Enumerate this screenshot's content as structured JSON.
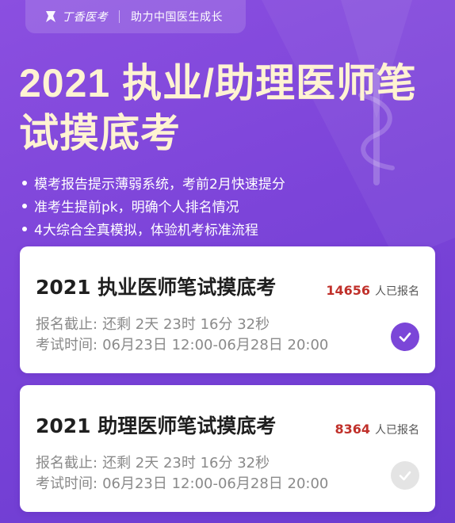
{
  "brand": {
    "name": "丁香医考",
    "slogan": "助力中国医生成长"
  },
  "headline": "2021 执业/助理医师笔试摸底考",
  "bullets": [
    "模考报告提示薄弱系统，考前2月快速提分",
    "准考生提前pk，明确个人排名情况",
    "4大综合全真模拟，体验机考标准流程"
  ],
  "exams": [
    {
      "title": "2021 执业医师笔试摸底考",
      "count": "14656",
      "count_label": "人已报名",
      "deadline_label": "报名截止:",
      "deadline_value": "还剩 2天 23时 16分 32秒",
      "time_label": "考试时间:",
      "time_value": "06月23日 12:00-06月28日 20:00",
      "selected": true
    },
    {
      "title": "2021 助理医师笔试摸底考",
      "count": "8364",
      "count_label": "人已报名",
      "deadline_label": "报名截止:",
      "deadline_value": "还剩 2天 23时 16分 32秒",
      "time_label": "考试时间:",
      "time_value": "06月23日 12:00-06月28日 20:00",
      "selected": false
    }
  ],
  "colors": {
    "background": "#7c44d9",
    "headline": "#fff3d2",
    "count": "#c0302a",
    "check_active": "#7b46d8",
    "check_inactive": "#e4e4e4"
  },
  "icons": [
    "logo-icon",
    "check-circle-icon"
  ]
}
